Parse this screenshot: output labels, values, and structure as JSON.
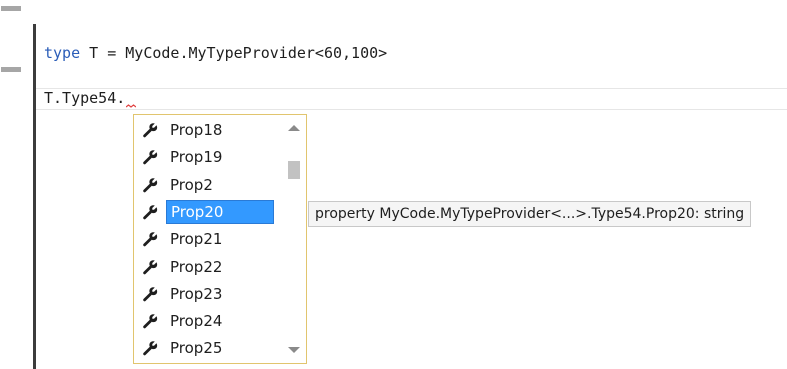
{
  "editor": {
    "line1": {
      "keyword": "type",
      "rest": " T = MyCode.MyTypeProvider<60,100>"
    },
    "line2": {
      "text": "T.Type54."
    }
  },
  "completion": {
    "items": [
      {
        "label": "Prop18",
        "icon": "wrench-icon"
      },
      {
        "label": "Prop19",
        "icon": "wrench-icon"
      },
      {
        "label": "Prop2",
        "icon": "wrench-icon"
      },
      {
        "label": "Prop20",
        "icon": "wrench-icon"
      },
      {
        "label": "Prop21",
        "icon": "wrench-icon"
      },
      {
        "label": "Prop22",
        "icon": "wrench-icon"
      },
      {
        "label": "Prop23",
        "icon": "wrench-icon"
      },
      {
        "label": "Prop24",
        "icon": "wrench-icon"
      },
      {
        "label": "Prop25",
        "icon": "wrench-icon"
      }
    ],
    "selected": "Prop20"
  },
  "tooltip": {
    "text": "property MyCode.MyTypeProvider<...>.Type54.Prop20: string"
  },
  "colors": {
    "keyword": "#2b5db8",
    "selection": "#3399ff",
    "completion_border": "#e1c56e",
    "squiggle": "#e04040"
  }
}
